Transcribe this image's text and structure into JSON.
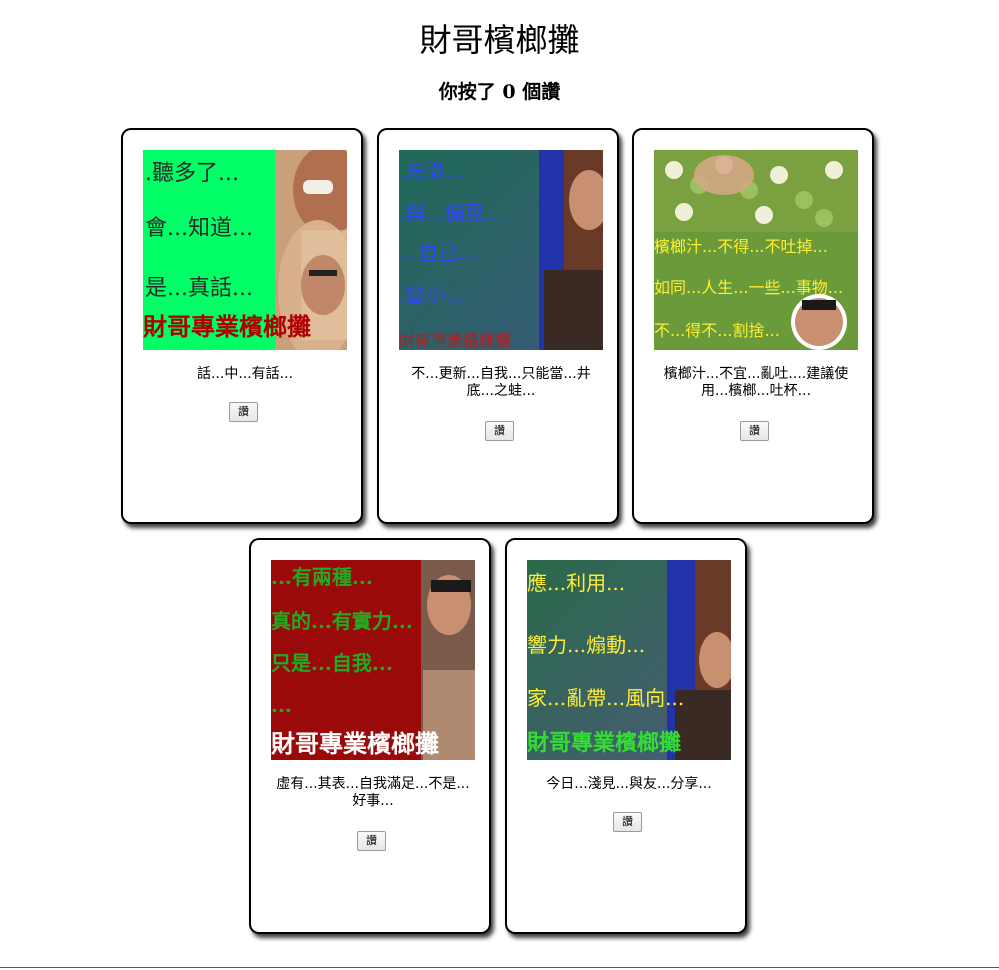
{
  "page": {
    "title": "財哥檳榔攤",
    "likes_text": "你按了 0 個讚"
  },
  "cards": [
    {
      "caption": "話...中...有話...",
      "button_label": "讚",
      "image_text": [
        ".聽多了...",
        "會...知道...",
        "是...真話...",
        "財哥專業檳榔攤"
      ]
    },
    {
      "caption": "不...更新...自我...只能當...井底...之蛙...",
      "button_label": "讚",
      "image_text": [
        ".充滿...",
        ".與...偏見...",
        "...自己...",
        ".變小...",
        "財哥專業檳榔攤"
      ]
    },
    {
      "caption": "檳榔汁...不宜...亂吐....建議使用...檳榔...吐杯...",
      "button_label": "讚",
      "image_text": [
        "檳榔汁...不得...不吐掉...",
        "如同...人生...一些...事物...",
        "不...得不...割捨..."
      ]
    },
    {
      "caption": "虛有...其表...自我滿足...不是...好事...",
      "button_label": "讚",
      "image_text": [
        "...有兩種...",
        "真的...有實力...",
        "只是...自我...",
        "...",
        "財哥專業檳榔攤"
      ]
    },
    {
      "caption": "今日...淺見...與友...分享...",
      "button_label": "讚",
      "image_text": [
        "應...利用...",
        "響力...煽動...",
        "家...亂帶...風向...",
        "財哥專業檳榔攤"
      ]
    }
  ]
}
